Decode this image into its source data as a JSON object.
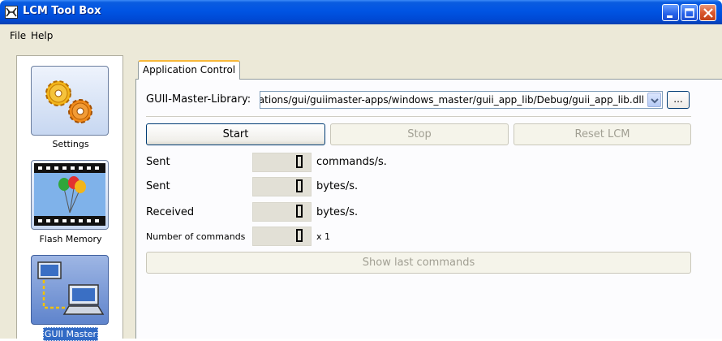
{
  "window": {
    "title": "LCM Tool Box"
  },
  "menu": {
    "file": "File",
    "help": "Help"
  },
  "sidebar": {
    "items": [
      {
        "label": "Settings",
        "icon": "gears-icon"
      },
      {
        "label": "Flash Memory",
        "icon": "film-balloons-icon"
      },
      {
        "label": "GUII Master",
        "icon": "computer-network-icon",
        "selected": true
      }
    ]
  },
  "tabs": {
    "active": "Application Control"
  },
  "library": {
    "label": "GUII-Master-Library:",
    "value": "pplications/gui/guiimaster-apps/windows_master/guii_app_lib/Debug/guii_app_lib.dll",
    "browse_label": "..."
  },
  "controls": {
    "start": "Start",
    "stop": "Stop",
    "reset": "Reset LCM",
    "show_last": "Show last commands"
  },
  "stats": [
    {
      "label": "Sent",
      "value": "0",
      "unit": "commands/s."
    },
    {
      "label": "Sent",
      "value": "0",
      "unit": "bytes/s."
    },
    {
      "label": "Received",
      "value": "0",
      "unit": "bytes/s."
    },
    {
      "label": "Number of commands",
      "value": "0",
      "unit": "x 1"
    }
  ],
  "colors": {
    "titlebar": "#0054e3",
    "selection": "#316ac5",
    "tab_highlight": "#f7b83a"
  }
}
